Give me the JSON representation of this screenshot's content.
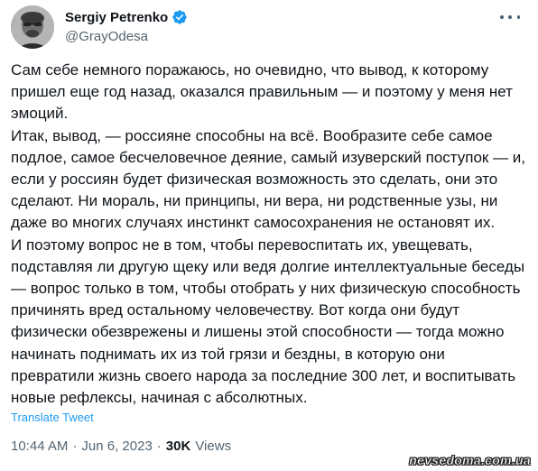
{
  "author": {
    "display_name": "Sergiy Petrenko",
    "handle": "@GrayOdesa",
    "verified_color": "#1d9bf0"
  },
  "tweet": {
    "paragraphs": [
      "Сам себе немного поражаюсь, но очевидно, что вывод, к которому пришел еще год назад, оказался правильным — и поэтому у меня нет эмоций.",
      "Итак, вывод, — россияне способны на всё. Вообразите себе самое подлое, самое бесчеловечное деяние, самый изуверский поступок — и, если у россиян будет физическая возможность это сделать, они это сделают. Ни мораль, ни принципы, ни вера, ни родственные узы, ни даже во многих случаях инстинкт самосохранения не остановят их.",
      "И поэтому вопрос не в том, чтобы перевоспитать их, увещевать, подставляя ли другую щеку или ведя долгие интеллектуальные беседы — вопрос только в том, чтобы отобрать у них физическую способность причинять вред остальному человечеству. Вот когда они будут физически обезврежены и лишены этой способности — тогда можно начинать поднимать их из той грязи и бездны, в которую они превратили жизнь своего народа за последние 300 лет, и воспитывать новые рефлексы, начиная с абсолютных."
    ],
    "translate_label": "Translate Tweet",
    "time": "10:44 AM",
    "separator": "·",
    "date": "Jun 6, 2023",
    "views_count": "30K",
    "views_label": "Views"
  },
  "watermark": "nevsedoma.com.ua",
  "icons": {
    "verified": "verified-badge-icon",
    "more": "more-options-icon"
  }
}
